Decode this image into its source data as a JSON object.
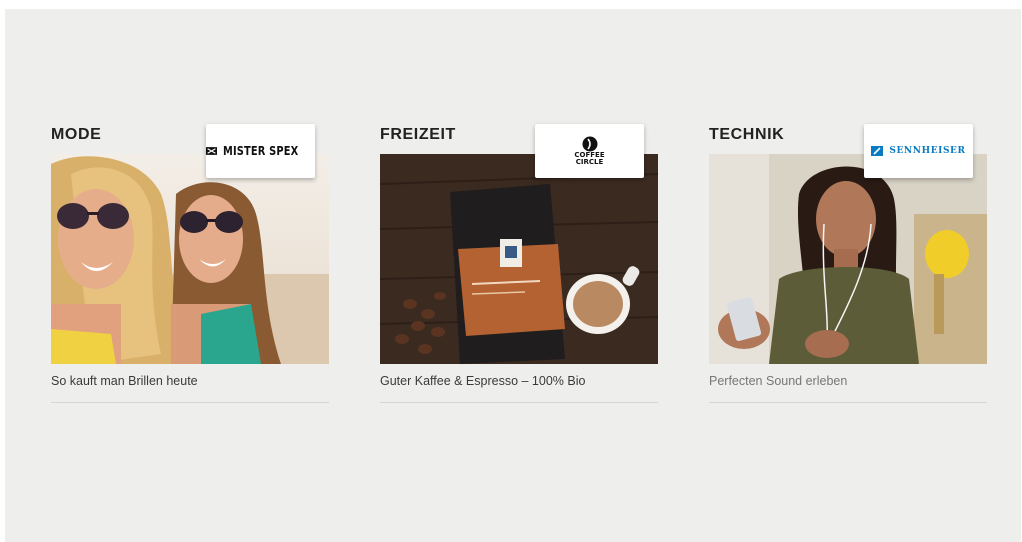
{
  "cards": [
    {
      "category": "MODE",
      "brand": "MISTER SPEX",
      "caption": "So kauft man Brillen heute",
      "image": "two-women-sunglasses-beach"
    },
    {
      "category": "FREIZEIT",
      "brand_line1": "COFFEE",
      "brand_line2": "CIRCLE",
      "caption": "Guter Kaffee & Espresso – 100% Bio",
      "image": "coffee-bag-and-cup"
    },
    {
      "category": "TECHNIK",
      "brand": "SENNHEISER",
      "caption": "Perfecten Sound erleben",
      "image": "woman-with-earphones-smartphone"
    }
  ],
  "colors": {
    "panel_bg": "#eeeeec",
    "sennheiser_blue": "#0a7bc2",
    "divider": "#d6d6d4"
  }
}
